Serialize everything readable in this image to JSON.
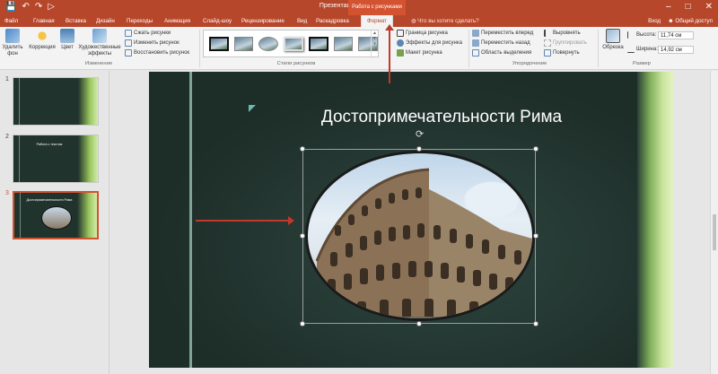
{
  "window": {
    "title": "Презентация1 - PowerPoint",
    "context_tab_title": "Работа с рисунками",
    "qat_icons": [
      "save-icon",
      "undo-icon",
      "redo-icon",
      "start-from-beginning-icon"
    ],
    "controls": [
      "minimize",
      "restore",
      "close"
    ]
  },
  "tabs": {
    "file": "Файл",
    "items": [
      "Главная",
      "Вставка",
      "Дизайн",
      "Переходы",
      "Анимация",
      "Слайд-шоу",
      "Рецензирование",
      "Вид",
      "Раскадровка"
    ],
    "active": "Формат",
    "tell_me": "Что вы хотите сделать?",
    "sign_in": "Вход",
    "share": "Общий доступ"
  },
  "ribbon": {
    "adjust": {
      "remove_bg": "Удалить фон",
      "corrections": "Коррекция",
      "color": "Цвет",
      "artistic": "Художественные эффекты",
      "compress": "Сжать рисунки",
      "change": "Изменить рисунок",
      "reset": "Восстановить рисунок",
      "label": "Изменение"
    },
    "styles": {
      "label": "Стили рисунков",
      "border": "Граница рисунка",
      "effects": "Эффекты для рисунка",
      "layout": "Макет рисунка"
    },
    "arrange": {
      "forward": "Переместить вперед",
      "backward": "Переместить назад",
      "selection": "Область выделения",
      "align": "Выровнять",
      "group": "Группировать",
      "rotate": "Повернуть",
      "label": "Упорядочение"
    },
    "size": {
      "crop": "Обрезка",
      "height_label": "Высота:",
      "height_value": "11,74 см",
      "width_label": "Ширина:",
      "width_value": "14,92 см",
      "label": "Размер"
    }
  },
  "thumbnails": [
    {
      "num": "1",
      "title": ""
    },
    {
      "num": "2",
      "title": "Работа с текстом"
    },
    {
      "num": "3",
      "title": "Достопримечательности Рима"
    }
  ],
  "slide": {
    "title": "Достопримечательности Рима"
  },
  "colors": {
    "accent": "#b7472a",
    "context_tab": "#d35230",
    "arrow": "#c0392b",
    "slide_bg": "#21332d"
  }
}
